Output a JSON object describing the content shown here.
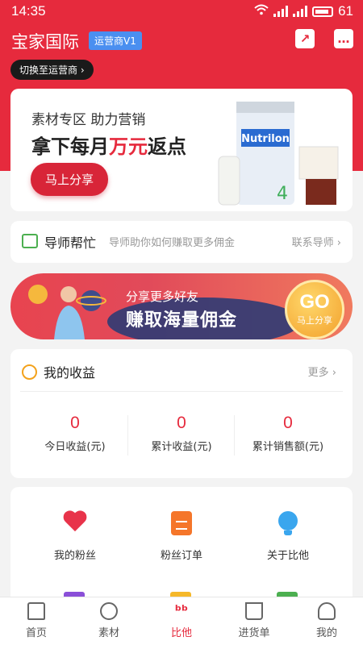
{
  "status_bar": {
    "time": "14:35",
    "battery": "61"
  },
  "header": {
    "title": "宝家国际",
    "badge": "运营商V1"
  },
  "switch_button": {
    "label": "切换至运营商 ›"
  },
  "banner": {
    "subtitle": "素材专区 助力营销",
    "headline_part1": "拿下每月",
    "headline_highlight": "万元",
    "headline_part2": "返点",
    "share_button": "马上分享",
    "product_text": "Nutrilon"
  },
  "tutor": {
    "label": "导师帮忙",
    "description": "导师助你如何赚取更多佣金",
    "link": "联系导师 ›"
  },
  "promo": {
    "line1": "分享更多好友",
    "line2": "赚取海量佣金",
    "go": "GO",
    "go_sub": "马上分享"
  },
  "income": {
    "title": "我的收益",
    "more": "更多 ›",
    "stats": [
      {
        "value": "0",
        "label": "今日收益(元)"
      },
      {
        "value": "0",
        "label": "累计收益(元)"
      },
      {
        "value": "0",
        "label": "累计销售额(元)"
      }
    ]
  },
  "grid": {
    "items": [
      {
        "label": "我的粉丝",
        "icon": "heart-icon"
      },
      {
        "label": "粉丝订单",
        "icon": "document-icon"
      },
      {
        "label": "关于比他",
        "icon": "lightbulb-icon"
      }
    ]
  },
  "tabbar": {
    "items": [
      {
        "label": "首页",
        "icon": "home-icon"
      },
      {
        "label": "素材",
        "icon": "planet-icon"
      },
      {
        "label": "比他",
        "icon": "bita-logo-icon"
      },
      {
        "label": "进货单",
        "icon": "cart-icon"
      },
      {
        "label": "我的",
        "icon": "user-icon"
      }
    ],
    "active_color": "#e62a3d"
  },
  "colors": {
    "brand_red": "#e62a3d",
    "badge_blue": "#4a8ff0"
  }
}
